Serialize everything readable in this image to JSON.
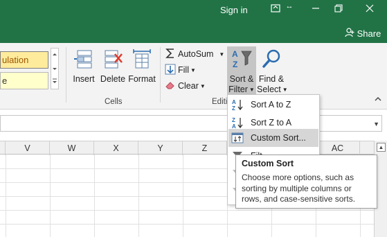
{
  "titlebar": {
    "signin_label": "Sign in",
    "share_label": "Share",
    "bg_color": "#217346"
  },
  "styles": {
    "calculation_label": "ulation",
    "second_label": "e"
  },
  "cells_group": {
    "label": "Cells",
    "insert_label": "Insert",
    "delete_label": "Delete",
    "format_label": "Format"
  },
  "editing_group": {
    "label": "Editi",
    "autosum_label": "AutoSum",
    "fill_label": "Fill",
    "clear_label": "Clear",
    "sort_filter_line1": "Sort &",
    "sort_filter_line2": "Filter",
    "find_select_line1": "Find &",
    "find_select_line2": "Select"
  },
  "columns": [
    "V",
    "W",
    "X",
    "Y",
    "Z",
    "AC"
  ],
  "sort_menu": {
    "items": [
      {
        "label": "Sort A to Z",
        "icon": "sort-a-to-z-icon"
      },
      {
        "label": "Sort Z to A",
        "icon": "sort-z-to-a-icon"
      },
      {
        "label": "Custom Sort...",
        "icon": "custom-sort-icon"
      },
      {
        "label": "Filt",
        "icon": "filter-icon"
      }
    ]
  },
  "tooltip": {
    "title": "Custom Sort",
    "description": "Choose more options, such as sorting by multiple columns or rows, and case-sensitive sorts."
  }
}
